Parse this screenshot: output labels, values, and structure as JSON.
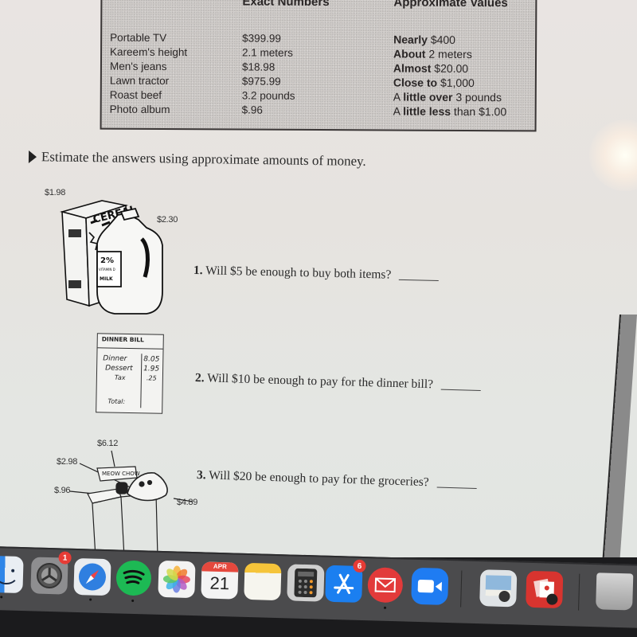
{
  "reference_table": {
    "headers": {
      "exact": "Exact Numbers",
      "approx": "Approximate Values"
    },
    "rows": [
      {
        "item": "Portable TV",
        "exact": "$399.99",
        "approx_bold": "Nearly",
        "approx_pre": "",
        "approx_rest": " $400"
      },
      {
        "item": "Kareem's height",
        "exact": "2.1 meters",
        "approx_bold": "About",
        "approx_pre": "",
        "approx_rest": " 2 meters"
      },
      {
        "item": "Men's jeans",
        "exact": "$18.98",
        "approx_bold": "Almost",
        "approx_pre": "",
        "approx_rest": " $20.00"
      },
      {
        "item": "Lawn tractor",
        "exact": "$975.99",
        "approx_bold": "Close to",
        "approx_pre": "",
        "approx_rest": " $1,000"
      },
      {
        "item": "Roast beef",
        "exact": "3.2 pounds",
        "approx_bold": "little over",
        "approx_pre": "A ",
        "approx_rest": " 3 pounds"
      },
      {
        "item": "Photo album",
        "exact": "$.96",
        "approx_bold": "little less",
        "approx_pre": "A ",
        "approx_rest": " than $1.00"
      }
    ]
  },
  "instruction": "Estimate the answers using approximate amounts of money.",
  "problems": [
    {
      "number": "1.",
      "question": "Will $5 be enough to buy both items?",
      "prices": {
        "cereal": "$1.98",
        "milk": "$2.30"
      },
      "illustration_text": {
        "cereal_box": "CEREAL",
        "milk_label_1": "2%",
        "milk_label_2": "VITAMIN D",
        "milk_label_3": "MILK"
      }
    },
    {
      "number": "2.",
      "question": "Will $10 be enough to pay for the dinner bill?",
      "bill": {
        "title": "DINNER BILL",
        "lines": [
          {
            "label": "Dinner",
            "amount": "8.05"
          },
          {
            "label": "Dessert",
            "amount": "1.95"
          },
          {
            "label": "Tax",
            "amount": ".25"
          }
        ],
        "total_label": "Total:"
      }
    },
    {
      "number": "3.",
      "question": "Will $20 be enough to pay for the groceries?",
      "prices": {
        "top": "$6.12",
        "left_upper": "$2.98",
        "left_lower": "$.96",
        "right": "$4.89"
      },
      "illustration_text": {
        "box": "MEOW CHOW"
      }
    }
  ],
  "dock": {
    "items": [
      {
        "name": "Finder",
        "icon": "finder-icon",
        "running": true
      },
      {
        "name": "System Preferences",
        "icon": "gear-icon",
        "badge": "1"
      },
      {
        "name": "Safari",
        "icon": "compass-icon",
        "running": true
      },
      {
        "name": "Spotify",
        "icon": "spotify-icon",
        "running": true
      },
      {
        "name": "Photos",
        "icon": "photos-flower-icon"
      },
      {
        "name": "Calendar",
        "icon": "calendar-icon",
        "month": "APR",
        "day": "21"
      },
      {
        "name": "Notes",
        "icon": "notes-icon"
      },
      {
        "name": "Calculator",
        "icon": "calculator-icon"
      },
      {
        "name": "App Store",
        "icon": "app-store-icon",
        "badge": "6"
      },
      {
        "name": "Mail",
        "icon": "envelope-icon",
        "running": true
      },
      {
        "name": "Zoom",
        "icon": "video-camera-icon"
      },
      {
        "name": "Preview",
        "icon": "preview-icon"
      },
      {
        "name": "Photo Booth",
        "icon": "photo-booth-icon"
      },
      {
        "name": "Trash",
        "icon": "trash-icon"
      }
    ]
  },
  "colors": {
    "badge": "#e63b35",
    "spotify": "#1db954",
    "safari": "#2f7fe0",
    "appstore": "#1b7ff0",
    "mail": "#e23a3a",
    "zoom": "#1f7cf2",
    "photo_booth": "#d8342f"
  }
}
